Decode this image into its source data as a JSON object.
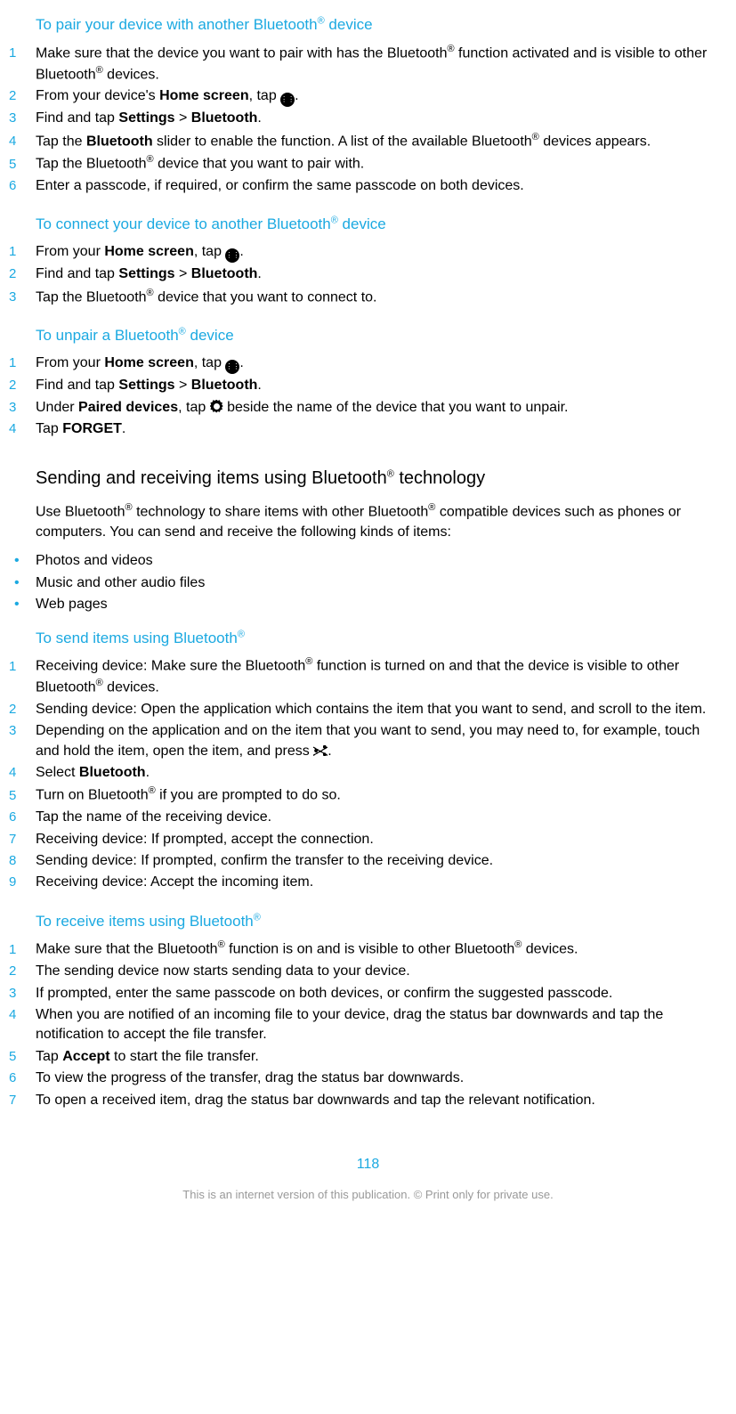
{
  "sections": {
    "pair": {
      "title_before": "To pair your device with another Bluetooth",
      "title_after": " device",
      "steps": [
        {
          "n": "1",
          "html": "Make sure that the device you want to pair with has the Bluetooth<sup>®</sup> function activated and is visible to other Bluetooth<sup>®</sup> devices."
        },
        {
          "n": "2",
          "html": "From your device's <span class='bold'>Home screen</span>, tap <span class='icon-apps' data-name='apps-icon' data-interactable='false'>⋮⋮</span>."
        },
        {
          "n": "3",
          "html": "Find and tap <span class='bold'>Settings</span> &gt; <span class='bold'>Bluetooth</span>."
        },
        {
          "n": "4",
          "html": "Tap the <span class='bold'>Bluetooth</span> slider to enable the function. A list of the available Bluetooth<sup>®</sup> devices appears."
        },
        {
          "n": "5",
          "html": "Tap the Bluetooth<sup>®</sup> device that you want to pair with."
        },
        {
          "n": "6",
          "html": "Enter a passcode, if required, or confirm the same passcode on both devices."
        }
      ]
    },
    "connect": {
      "title_before": "To connect your device to another Bluetooth",
      "title_after": " device",
      "steps": [
        {
          "n": "1",
          "html": "From your <span class='bold'>Home screen</span>, tap <span class='icon-apps' data-name='apps-icon' data-interactable='false'>⋮⋮</span>."
        },
        {
          "n": "2",
          "html": "Find and tap <span class='bold'>Settings</span> &gt; <span class='bold'>Bluetooth</span>."
        },
        {
          "n": "3",
          "html": "Tap the Bluetooth<sup>®</sup> device that you want to connect to."
        }
      ]
    },
    "unpair": {
      "title_before": "To unpair a Bluetooth",
      "title_after": " device",
      "steps": [
        {
          "n": "1",
          "html": "From your <span class='bold'>Home screen</span>, tap <span class='icon-apps' data-name='apps-icon' data-interactable='false'>⋮⋮</span>."
        },
        {
          "n": "2",
          "html": "Find and tap <span class='bold'>Settings</span> &gt; <span class='bold'>Bluetooth</span>."
        },
        {
          "n": "3",
          "html": "Under <span class='bold'>Paired devices</span>, tap <span class='icon-gear' data-name='gear-icon' data-interactable='false'></span> beside the name of the device that you want to unpair."
        },
        {
          "n": "4",
          "html": "Tap <span class='bold'>FORGET</span>."
        }
      ]
    },
    "sending": {
      "heading_before": "Sending and receiving items using Bluetooth",
      "heading_after": " technology",
      "para_html": "Use Bluetooth<sup>®</sup> technology to share items with other Bluetooth<sup>®</sup> compatible devices such as phones or computers. You can send and receive the following kinds of items:",
      "bullets": [
        "Photos and videos",
        "Music and other audio files",
        "Web pages"
      ]
    },
    "send": {
      "title_before": "To send items using Bluetooth",
      "title_after": "",
      "steps": [
        {
          "n": "1",
          "html": "Receiving device: Make sure the Bluetooth<sup>®</sup> function is turned on and that the device is visible to other Bluetooth<sup>®</sup> devices."
        },
        {
          "n": "2",
          "html": "Sending device: Open the application which contains the item that you want to send, and scroll to the item."
        },
        {
          "n": "3",
          "html": "Depending on the application and on the item that you want to send, you may need to, for example, touch and hold the item, open the item, and press <span class='icon-share' data-name='share-icon' data-interactable='false'></span>."
        },
        {
          "n": "4",
          "html": "Select <span class='bold'>Bluetooth</span>."
        },
        {
          "n": "5",
          "html": "Turn on Bluetooth<sup>®</sup> if you are prompted to do so."
        },
        {
          "n": "6",
          "html": "Tap the name of the receiving device."
        },
        {
          "n": "7",
          "html": "Receiving device: If prompted, accept the connection."
        },
        {
          "n": "8",
          "html": "Sending device: If prompted, confirm the transfer to the receiving device."
        },
        {
          "n": "9",
          "html": "Receiving device: Accept the incoming item."
        }
      ]
    },
    "receive": {
      "title_before": "To receive items using Bluetooth",
      "title_after": "",
      "steps": [
        {
          "n": "1",
          "html": "Make sure that the Bluetooth<sup>®</sup> function is on and is visible to other Bluetooth<sup>®</sup> devices."
        },
        {
          "n": "2",
          "html": "The sending device now starts sending data to your device."
        },
        {
          "n": "3",
          "html": "If prompted, enter the same passcode on both devices, or confirm the suggested passcode."
        },
        {
          "n": "4",
          "html": "When you are notified of an incoming file to your device, drag the status bar downwards and tap the notification to accept the file transfer."
        },
        {
          "n": "5",
          "html": "Tap <span class='bold'>Accept</span> to start the file transfer."
        },
        {
          "n": "6",
          "html": "To view the progress of the transfer, drag the status bar downwards."
        },
        {
          "n": "7",
          "html": "To open a received item, drag the status bar downwards and tap the relevant notification."
        }
      ]
    }
  },
  "page_number": "118",
  "footer": "This is an internet version of this publication. © Print only for private use."
}
